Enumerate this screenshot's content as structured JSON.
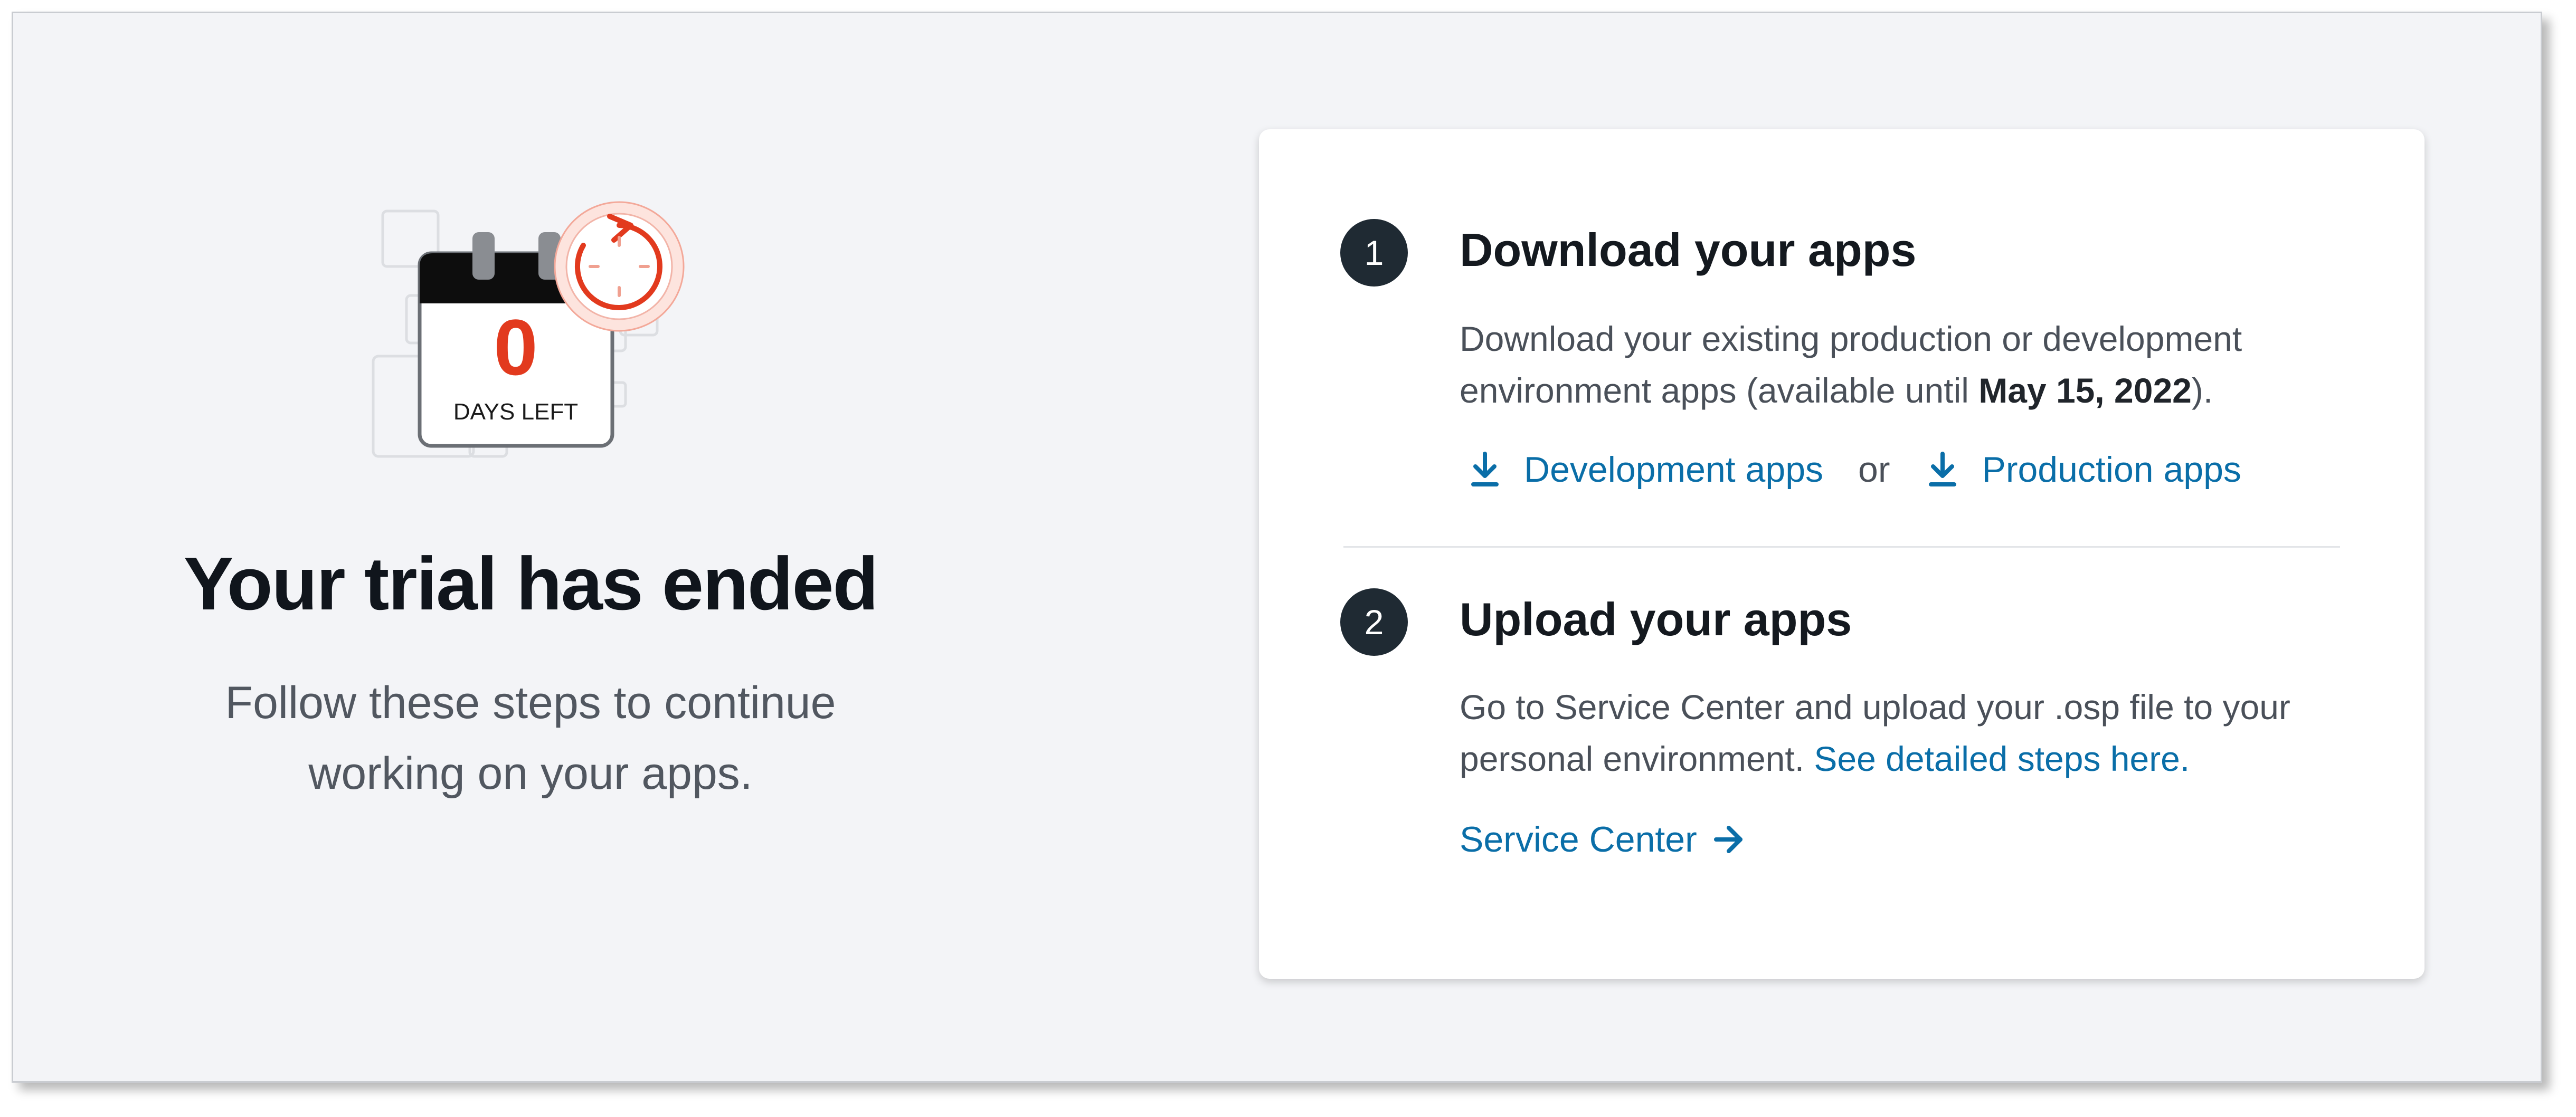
{
  "left": {
    "calendar_number": "0",
    "calendar_caption": "DAYS LEFT",
    "title": "Your trial has ended",
    "subtitle": "Follow these steps to continue working on your apps."
  },
  "steps": [
    {
      "number": "1",
      "title": "Download your apps",
      "desc_before": "Download your existing production or development environment apps (available until ",
      "desc_bold": "May 15, 2022",
      "desc_after": ").",
      "link_dev": "Development apps",
      "or": "or",
      "link_prod": "Production apps"
    },
    {
      "number": "2",
      "title": "Upload your apps",
      "desc_before": "Go to Service Center and upload your .osp file to your personal environment. ",
      "desc_link": "See detailed steps here.",
      "action_link": "Service Center"
    }
  ],
  "icons": {
    "calendar": "calendar-icon",
    "timer": "timer-reset-icon",
    "download": "download-icon",
    "arrow": "arrow-right-icon"
  },
  "colors": {
    "accent_red": "#e23a1e",
    "link_blue": "#0a6ea8",
    "step_badge": "#1f2a33",
    "background": "#f3f4f7"
  }
}
